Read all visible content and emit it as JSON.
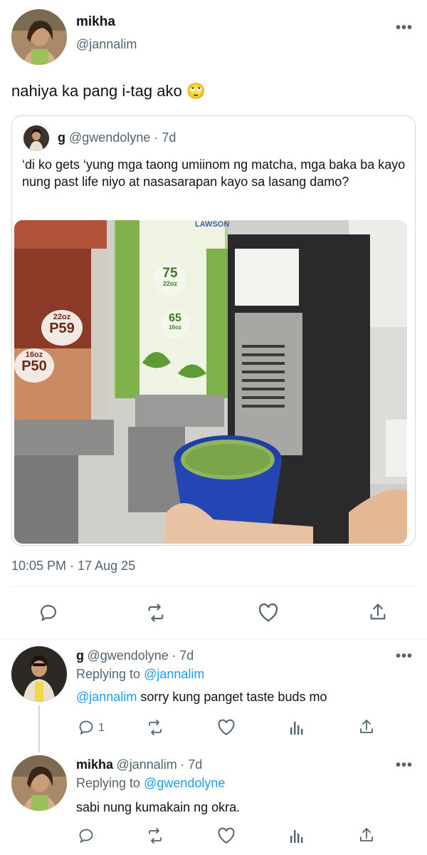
{
  "main_tweet": {
    "display_name": "mikha",
    "handle": "@jannalim",
    "text": "nahiya ka pang i-tag ako",
    "emoji": "🙄",
    "timestamp": "10:05 PM · 17 Aug 25"
  },
  "quoted_tweet": {
    "display_name": "g",
    "handle": "@gwendolyne",
    "time": "· 7d",
    "text": "‘di ko gets ‘yung mga taong umiinom ng matcha, mga baka ba kayo nung past life niyo at nasasarapan kayo sa lasang damo?",
    "image": {
      "store_logo": "LAWSON",
      "price_left_1": "P59",
      "size_left_1": "22oz",
      "price_left_2": "P50",
      "size_left_2": "16oz",
      "price_right_1": "75",
      "size_right_1": "22oz",
      "price_right_2": "65",
      "size_right_2": "16oz"
    }
  },
  "replies": [
    {
      "display_name": "g",
      "handle": "@gwendolyne",
      "time": "· 7d",
      "replying_prefix": "Replying to",
      "replying_to": "@jannalim",
      "mention": "@jannalim",
      "body": " sorry kung panget taste buds mo",
      "reply_count": "1"
    },
    {
      "display_name": "mikha",
      "handle": "@jannalim",
      "time": "· 7d",
      "replying_prefix": "Replying to",
      "replying_to": "@gwendolyne",
      "body": "sabi nung kumakain ng okra."
    }
  ],
  "icons": [
    "reply-icon",
    "retweet-icon",
    "like-icon",
    "share-icon",
    "analytics-icon",
    "more-icon"
  ],
  "colors": {
    "link": "#1d9bf0",
    "secondary_text": "#536471",
    "border": "#cfd9de"
  }
}
